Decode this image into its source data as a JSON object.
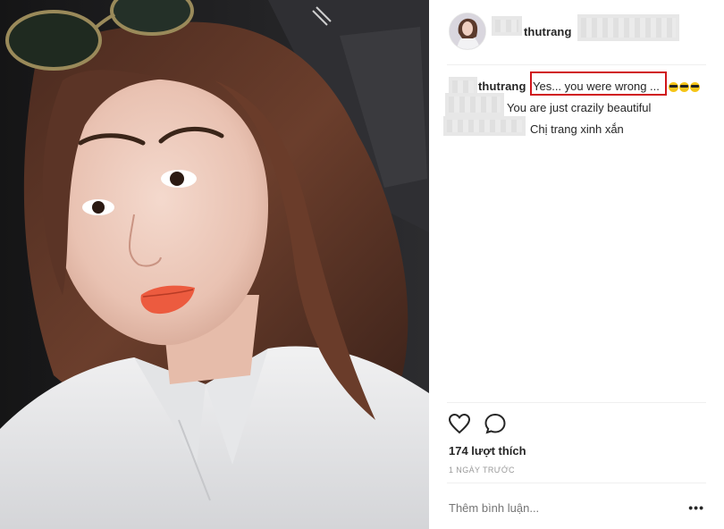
{
  "post": {
    "username": "thutrang",
    "like_count": "174 lượt thích",
    "time_ago": "1 NGÀY TRƯỚC",
    "comment_placeholder": "Thêm bình luận..."
  },
  "comments": [
    {
      "username": "thutrang",
      "text": "Yes... you were wrong ...",
      "highlighted": true,
      "emoji_count": 3
    },
    {
      "username": "",
      "text": "You are just crazily beautiful"
    },
    {
      "username": "",
      "text": "Chị trang xinh xắn"
    }
  ],
  "icons": {
    "like": "heart-outline-icon",
    "comment": "speech-bubble-icon",
    "more": "more-options-icon"
  },
  "colors": {
    "highlight_border": "#d0161b",
    "text": "#262626",
    "muted": "#999999"
  }
}
